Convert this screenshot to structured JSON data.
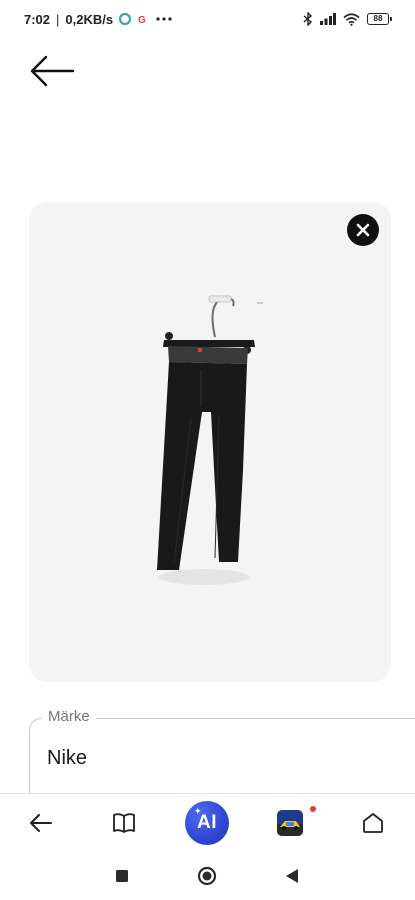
{
  "status_bar": {
    "time": "7:02",
    "speed": "0,2KB/s",
    "battery": "88",
    "icons": [
      "opera-icon",
      "google-icon",
      "more-dots-icon",
      "bluetooth-icon",
      "signal-icon",
      "wifi-icon",
      "battery-icon"
    ]
  },
  "header": {
    "back_icon": "arrow-left-icon"
  },
  "image_card": {
    "image": "black-leggings-on-hanger",
    "close_icon": "close-icon"
  },
  "brand_field": {
    "label": "Märke",
    "value": "Nike"
  },
  "browser_bar": {
    "items": [
      "back-icon",
      "book-icon",
      "ai-button",
      "game-app-icon",
      "home-icon"
    ],
    "ai_label": "AI"
  },
  "system_nav": {
    "items": [
      "recents-square-icon",
      "home-circle-icon",
      "back-triangle-icon"
    ]
  },
  "colors": {
    "card_background": "#f4f4f4",
    "ai_button": "#2f46d3",
    "notification_dot": "#e53935"
  }
}
